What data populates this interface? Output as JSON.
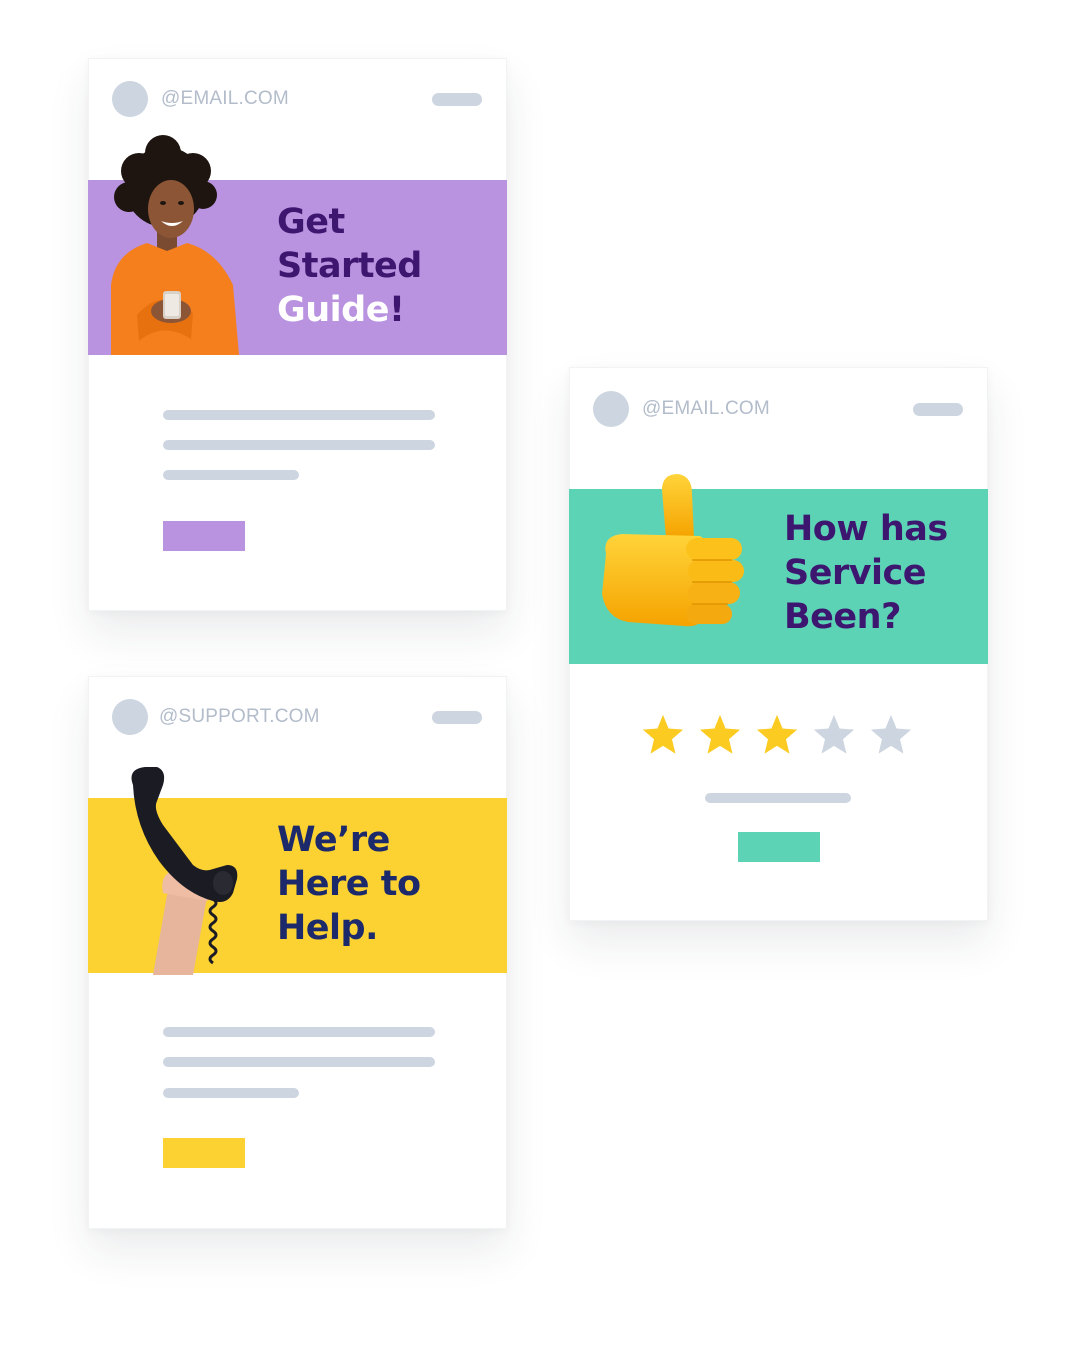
{
  "cards": [
    {
      "sender": "@EMAIL.COM",
      "headline": [
        "Get",
        "Started",
        "Guide"
      ],
      "headline_suffix": "!",
      "banner_color": "#b993e0",
      "headline_color": "#3d1670",
      "accent_color": "#ffffff",
      "cta_color": "#b993e0",
      "image": "woman-with-phone"
    },
    {
      "sender": "@SUPPORT.COM",
      "headline": [
        "We’re",
        "Here to",
        "Help."
      ],
      "banner_color": "#fbd232",
      "headline_color": "#1c2a6b",
      "cta_color": "#fbd232",
      "image": "telephone-handset"
    },
    {
      "sender": "@EMAIL.COM",
      "headline": [
        "How has",
        "Service",
        "Been?"
      ],
      "banner_color": "#5dd3b6",
      "headline_color": "#3d1670",
      "cta_color": "#5dd3b6",
      "image": "thumbs-up",
      "rating": {
        "value": 3,
        "max": 5
      },
      "star_colors": {
        "filled": "#fbcb22",
        "empty": "#cdd5e0"
      }
    }
  ]
}
